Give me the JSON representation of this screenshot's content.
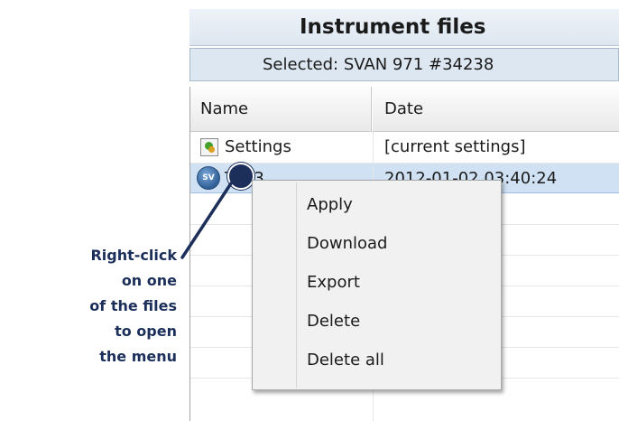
{
  "panel": {
    "title": "Instrument files",
    "selected": "Selected: SVAN 971 #34238"
  },
  "table": {
    "columns": [
      "Name",
      "Date"
    ],
    "rows": [
      {
        "name": "Settings",
        "date": "[current settings]",
        "icon": "settings-file-icon",
        "selected": false
      },
      {
        "name": "TTT3",
        "date": "2012-01-02 03:40:24",
        "icon": "svan-measurement-file-icon",
        "selected": true
      }
    ]
  },
  "context_menu": {
    "items": [
      "Apply",
      "Download",
      "Export",
      "Delete",
      "Delete all"
    ]
  },
  "annotation": {
    "text_lines": [
      "Right-click on one",
      "of the files to open",
      "the menu"
    ],
    "color": "#1b2f5a"
  },
  "icons": {
    "svan_badge": "SV"
  }
}
